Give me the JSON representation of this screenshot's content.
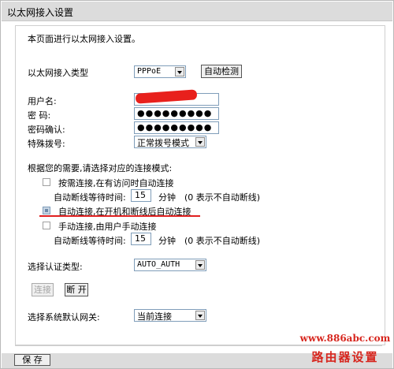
{
  "window": {
    "title": "以太网接入设置"
  },
  "intro": "本页面进行以太网接入设置。",
  "connection_type": {
    "label": "以太网接入类型",
    "value": "PPPoE",
    "detect_button": "自动检测"
  },
  "username": {
    "label": "用户名:"
  },
  "password": {
    "label": "密  码:",
    "value": "●●●●●●●●●"
  },
  "confirm_password": {
    "label": "密码确认:",
    "value": "●●●●●●●●●"
  },
  "dial_mode": {
    "label": "特殊拨号:",
    "value": "正常拨号模式"
  },
  "mode_prompt": "根据您的需要,请选择对应的连接模式:",
  "modes": [
    {
      "label": "按需连接,在有访问时自动连接",
      "checked": false,
      "wait": {
        "label": "自动断线等待时间:",
        "value": "15",
        "unit": "分钟",
        "note": "(0 表示不自动断线)"
      }
    },
    {
      "label": "自动连接,在开机和断线后自动连接",
      "checked": true
    },
    {
      "label": "手动连接,由用户手动连接",
      "checked": false,
      "wait": {
        "label": "自动断线等待时间:",
        "value": "15",
        "unit": "分钟",
        "note": "(0 表示不自动断线)"
      }
    }
  ],
  "auth": {
    "label": "选择认证类型:",
    "value": "AUTO_AUTH"
  },
  "actions": {
    "connect": "连接",
    "disconnect": "断 开"
  },
  "gateway": {
    "label": "选择系统默认网关:",
    "value": "当前连接"
  },
  "footer": {
    "save": "保 存"
  },
  "watermark": {
    "url": "www.886abc.com",
    "text": "路由器设置"
  },
  "colors": {
    "highlight": "#e02020",
    "title_bar": "#dcdcdc"
  }
}
